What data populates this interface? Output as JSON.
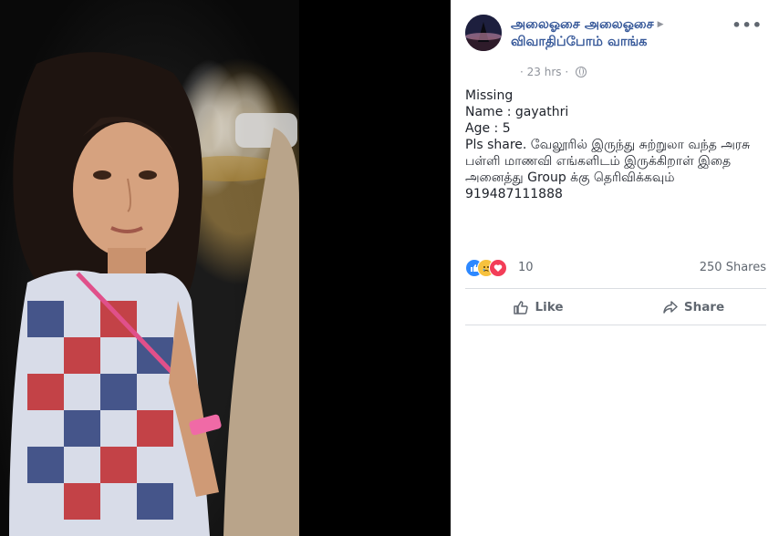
{
  "post": {
    "author_line1": "அலைஓசை அலைஓசை",
    "author_line2": "விவாதிப்போம் வாங்க",
    "time": "23 hrs",
    "more_label": "•••",
    "lines": [
      "Missing",
      "Name : gayathri",
      "Age : 5",
      "Pls share. வேலூரில் இருந்து சுற்றுலா வந்த அரசு பள்ளி மாணவி எங்களிடம் இருக்கிறாள் இதை அனைத்து Group க்கு தெரிவிக்கவும்",
      "919487111888"
    ]
  },
  "stats": {
    "reaction_icons": [
      "like-icon",
      "sad-icon",
      "love-icon"
    ],
    "reaction_count": "10",
    "shares": "250 Shares"
  },
  "actions": {
    "like_label": "Like",
    "share_label": "Share"
  },
  "colors": {
    "link": "#365899",
    "text": "#1d2129",
    "muted": "#606770"
  }
}
